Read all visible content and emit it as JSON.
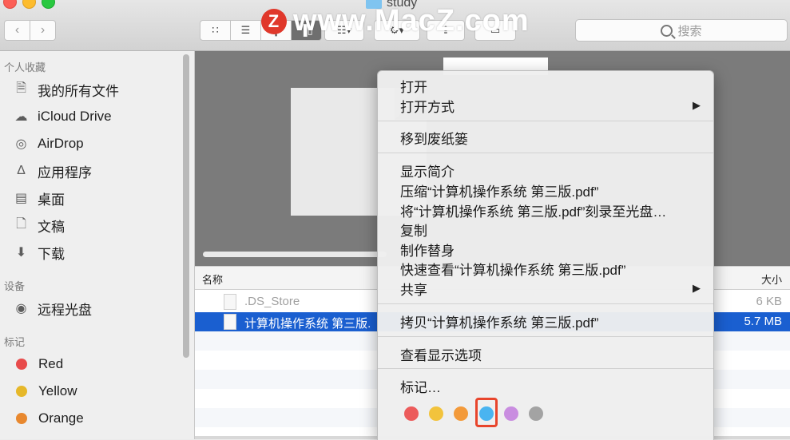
{
  "window": {
    "title": "study"
  },
  "watermark": {
    "logo": "Z",
    "text": "www.MacZ.com"
  },
  "toolbar": {
    "back_icon": "chevron-left-icon",
    "forward_icon": "chevron-right-icon",
    "search_placeholder": "搜索"
  },
  "sidebar": {
    "favorites_header": "个人收藏",
    "favorites": [
      {
        "label": "我的所有文件",
        "icon": "all-files-icon"
      },
      {
        "label": "iCloud Drive",
        "icon": "cloud-icon"
      },
      {
        "label": "AirDrop",
        "icon": "airdrop-icon"
      },
      {
        "label": "应用程序",
        "icon": "applications-icon"
      },
      {
        "label": "桌面",
        "icon": "desktop-icon"
      },
      {
        "label": "文稿",
        "icon": "documents-icon"
      },
      {
        "label": "下载",
        "icon": "download-icon"
      }
    ],
    "devices_header": "设备",
    "devices": [
      {
        "label": "远程光盘",
        "icon": "disc-icon"
      }
    ],
    "tags_header": "标记",
    "tags": [
      {
        "label": "Red",
        "color": "#e84b4b"
      },
      {
        "label": "Yellow",
        "color": "#e6b82a"
      },
      {
        "label": "Orange",
        "color": "#e8882e"
      }
    ]
  },
  "file_list": {
    "col_name": "名称",
    "col_size": "大小",
    "rows": [
      {
        "name": ".DS_Store",
        "size": "6 KB"
      },
      {
        "name": "计算机操作系统 第三版.",
        "size": "5.7 MB"
      }
    ]
  },
  "context_menu": {
    "open": "打开",
    "open_with": "打开方式",
    "trash": "移到废纸篓",
    "get_info": "显示简介",
    "compress": "压缩“计算机操作系统 第三版.pdf”",
    "burn": "将“计算机操作系统 第三版.pdf”刻录至光盘…",
    "duplicate": "复制",
    "make_alias": "制作替身",
    "quick_look": "快速查看“计算机操作系统 第三版.pdf”",
    "share": "共享",
    "copy": "拷贝“计算机操作系统 第三版.pdf”",
    "view_options": "查看显示选项",
    "tags": "标记…",
    "tag_colors": [
      "#ec5b5b",
      "#f2c33c",
      "#f39a3a",
      "#4ab4f0",
      "#c98de0",
      "#a3a3a3"
    ],
    "highlighted_color": "#4ab4f0"
  }
}
